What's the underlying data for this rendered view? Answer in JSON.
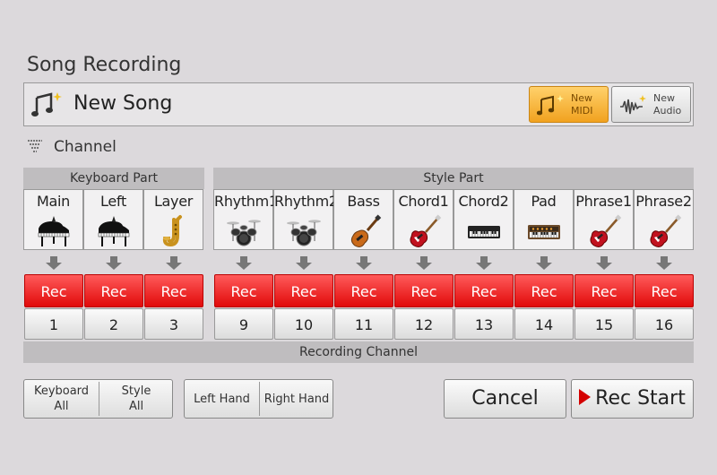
{
  "dialog": {
    "title": "Song Recording"
  },
  "song": {
    "name": "New Song",
    "new_midi": [
      "New",
      "MIDI"
    ],
    "new_audio": [
      "New",
      "Audio"
    ]
  },
  "channel": {
    "label": "Channel"
  },
  "groups": {
    "keyboard": "Keyboard Part",
    "style": "Style Part",
    "recording_channel": "Recording Channel"
  },
  "keyboard_parts": [
    {
      "name": "Main",
      "icon": "grand-piano-icon",
      "rec": "Rec",
      "channel": "1"
    },
    {
      "name": "Left",
      "icon": "grand-piano-icon",
      "rec": "Rec",
      "channel": "2"
    },
    {
      "name": "Layer",
      "icon": "saxophone-icon",
      "rec": "Rec",
      "channel": "3"
    }
  ],
  "style_parts": [
    {
      "name": "Rhythm1",
      "icon": "drum-kit-icon",
      "rec": "Rec",
      "channel": "9"
    },
    {
      "name": "Rhythm2",
      "icon": "drum-kit-icon",
      "rec": "Rec",
      "channel": "10"
    },
    {
      "name": "Bass",
      "icon": "bass-guitar-icon",
      "rec": "Rec",
      "channel": "11"
    },
    {
      "name": "Chord1",
      "icon": "electric-guitar-icon",
      "rec": "Rec",
      "channel": "12"
    },
    {
      "name": "Chord2",
      "icon": "keyboard-icon",
      "rec": "Rec",
      "channel": "13"
    },
    {
      "name": "Pad",
      "icon": "synthesizer-icon",
      "rec": "Rec",
      "channel": "14"
    },
    {
      "name": "Phrase1",
      "icon": "electric-guitar-icon",
      "rec": "Rec",
      "channel": "15"
    },
    {
      "name": "Phrase2",
      "icon": "electric-guitar-icon",
      "rec": "Rec",
      "channel": "16"
    }
  ],
  "buttons": {
    "keyboard_all": [
      "Keyboard",
      "All"
    ],
    "style_all": [
      "Style",
      "All"
    ],
    "left_hand": "Left Hand",
    "right_hand": "Right Hand",
    "cancel": "Cancel",
    "rec_start": "Rec Start"
  },
  "colors": {
    "rec_red": "#e10a0a",
    "accent_orange": "#f1a21f",
    "background": "#dcd9dc"
  }
}
